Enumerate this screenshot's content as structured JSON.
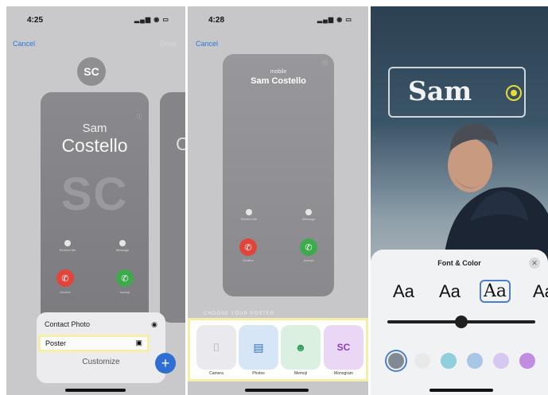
{
  "panel1": {
    "time": "4:25",
    "cancel": "Cancel",
    "done": "Done",
    "avatar_initials": "SC",
    "card": {
      "first": "Sam",
      "last": "Costello",
      "monogram": "SC"
    },
    "buttons": {
      "remind": "Remind Me",
      "message": "Message",
      "decline": "Decline",
      "accept": "Accept"
    },
    "peek_letter": "C",
    "menu": {
      "contact_photo": "Contact Photo",
      "poster": "Poster",
      "customize": "Customize"
    }
  },
  "panel2": {
    "time": "4:28",
    "cancel": "Cancel",
    "card": {
      "label": "mobile",
      "name": "Sam Costello"
    },
    "buttons": {
      "remind": "Remind Me",
      "message": "Message",
      "decline": "Decline",
      "accept": "Accept"
    },
    "choose_label": "CHOOSE YOUR POSTER",
    "options": [
      {
        "label": "Camera",
        "color": "#e9e9ee"
      },
      {
        "label": "Photos",
        "color": "#d6e6f7"
      },
      {
        "label": "Memoji",
        "color": "#dcf0e2"
      },
      {
        "label": "Monogram",
        "glyph": "SC",
        "color": "#ead7f6"
      }
    ]
  },
  "panel3": {
    "name": "Sam",
    "sheet_title": "Font & Color",
    "font_samples": [
      "Aa",
      "Aa",
      "Aa",
      "Aa"
    ],
    "slider_value": 0.5,
    "swatches": [
      "#7f8a94",
      "#e9e9ea",
      "#8fd0dc",
      "#a9c6e6",
      "#d6c8f0",
      "#c28de0"
    ]
  },
  "colors": {
    "accent": "#2c78d9",
    "highlight": "#f5eea6",
    "decline": "#e0443a",
    "accept": "#3dab4c"
  }
}
